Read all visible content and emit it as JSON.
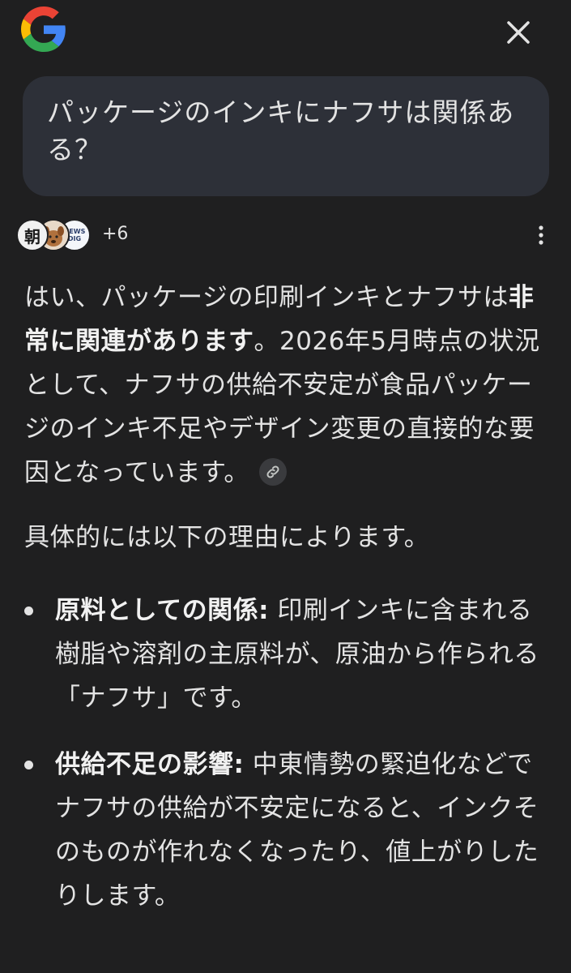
{
  "header": {
    "logo_icon": "google-g-logo",
    "close_icon": "close-icon"
  },
  "query": {
    "text": "パッケージのインキにナフサは関係ある？"
  },
  "sources": {
    "avatar_a_text": "朝",
    "avatar_b_icon": "dog-avatar",
    "avatar_c_text": "NEWS DIG",
    "count": "+6",
    "more_icon": "more-vert-icon"
  },
  "answer": {
    "p1_a": "はい、パッケージの印刷インキとナフサは",
    "p1_bold": "非常に関連があります",
    "p1_b": "。2026年5月時点の状況として、ナフサの供給不安定が食品パッケージのインキ不足やデザイン変更の直接的な要因となっています。",
    "link_icon": "link-icon",
    "p2": "具体的には以下の理由によります。",
    "bullets": [
      {
        "title": "原料としての関係:",
        "text": " 印刷インキに含まれる樹脂や溶剤の主原料が、原油から作られる「ナフサ」です。"
      },
      {
        "title": "供給不足の影響:",
        "text": " 中東情勢の緊迫化などでナフサの供給が不安定になると、インクそのものが作れなくなったり、値上がりしたりします。"
      }
    ]
  },
  "colors": {
    "background": "#1f1f20",
    "bubble": "#2d3038",
    "text": "#e3e3e3"
  }
}
